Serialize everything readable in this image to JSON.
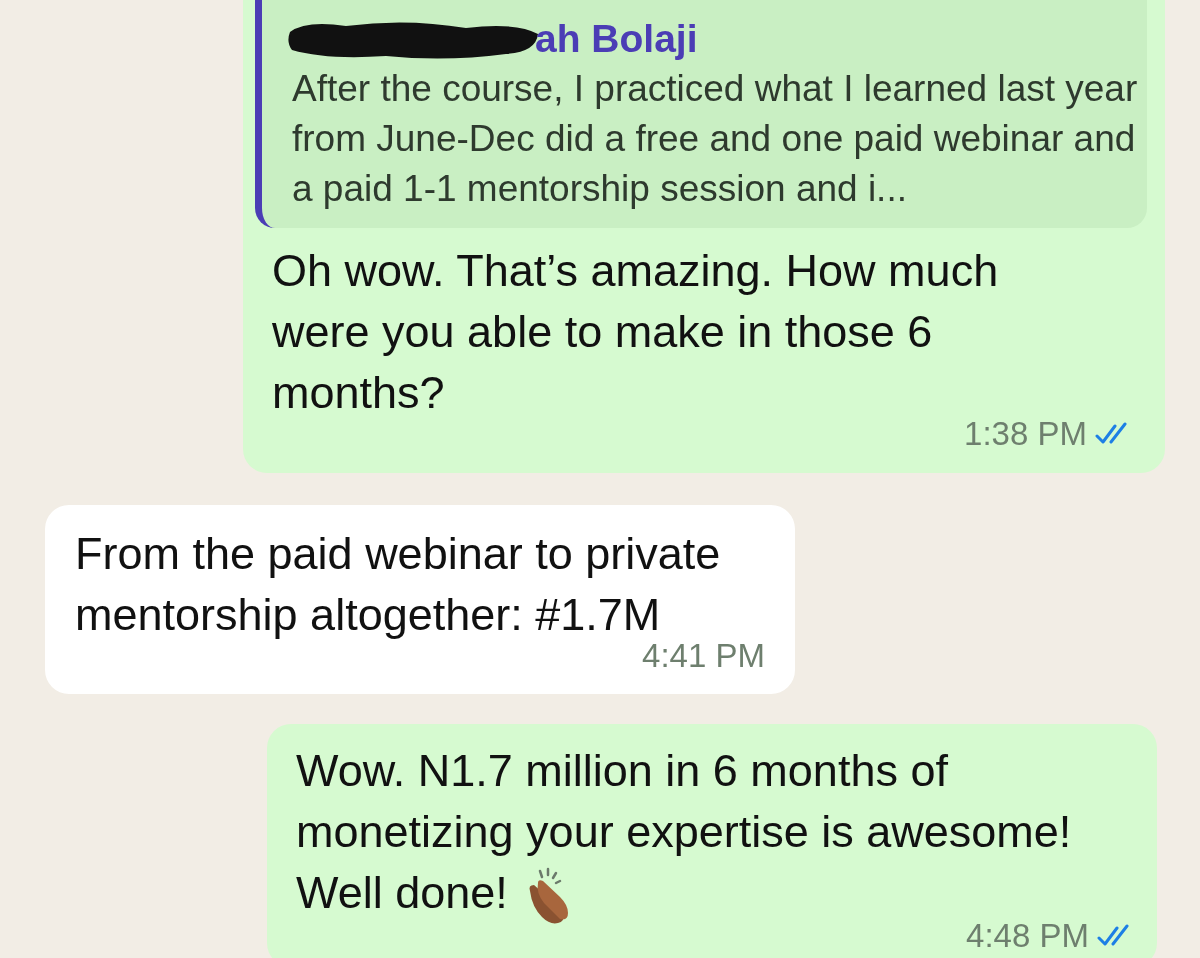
{
  "messages": [
    {
      "kind": "outgoing",
      "quote": {
        "author": "ah Bolaji",
        "redacted": true,
        "text": "After the course, I practiced what I learned last year from June-Dec did a free and one paid webinar and a paid 1-1 mentorship session and i..."
      },
      "text": "Oh wow. That’s amazing. How much were you able to make in those 6 months?",
      "time": "1:38 PM",
      "read": true
    },
    {
      "kind": "incoming",
      "text": "From the paid webinar to private mentorship altogether: #1.7M",
      "time": "4:41 PM"
    },
    {
      "kind": "outgoing",
      "text": "Wow. N1.7 million in 6 months of monetizing your expertise is awesome! Well done!",
      "clap_emoji": true,
      "time": "4:48 PM",
      "read": true
    }
  ]
}
